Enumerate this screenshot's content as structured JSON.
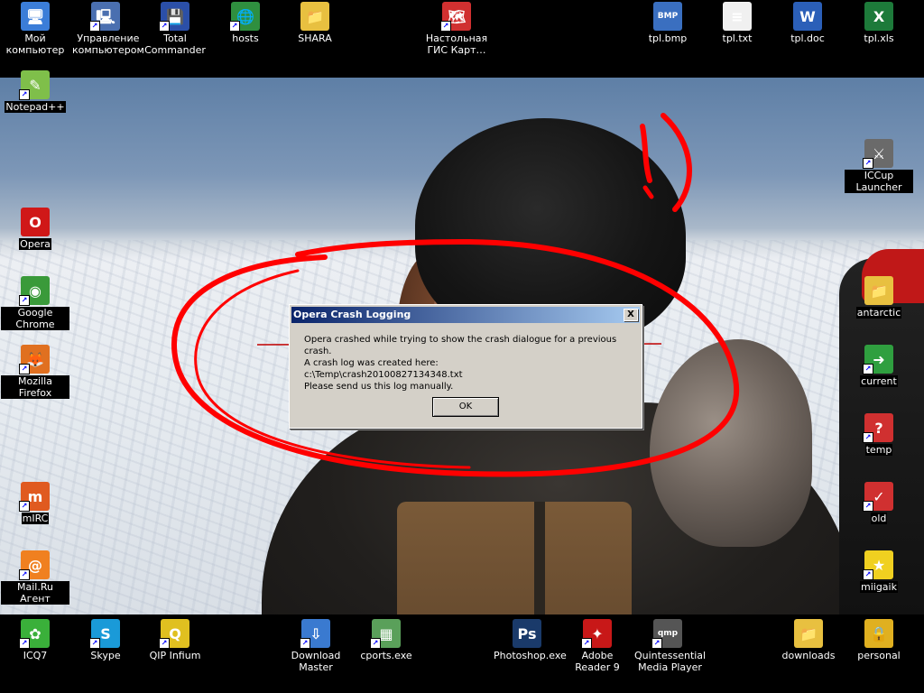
{
  "desktop": {
    "top_row": [
      {
        "name": "my-computer",
        "label": "Мой компьютер",
        "glyph": "🖥",
        "color": "#3b7dd8",
        "shortcut": false
      },
      {
        "name": "computer-management",
        "label": "Управление компьютером",
        "glyph": "🖳",
        "color": "#4a6fb0",
        "shortcut": true
      },
      {
        "name": "total-commander",
        "label": "Total Commander",
        "glyph": "💾",
        "color": "#2b4fa8",
        "shortcut": true
      },
      {
        "name": "hosts",
        "label": "hosts",
        "glyph": "🌐",
        "color": "#2f8f3f",
        "shortcut": true
      },
      {
        "name": "shara",
        "label": "SHARA",
        "glyph": "📁",
        "color": "#e8c040",
        "shortcut": false
      },
      {
        "name": "gis-kart",
        "label": "Настольная ГИС Карт…",
        "glyph": "🗺",
        "color": "#d03030",
        "shortcut": true
      },
      {
        "name": "tpl-bmp",
        "label": "tpl.bmp",
        "glyph": "BMP",
        "color": "#3a6fc0",
        "shortcut": false
      },
      {
        "name": "tpl-txt",
        "label": "tpl.txt",
        "glyph": "≡",
        "color": "#f0f0f0",
        "shortcut": false
      },
      {
        "name": "tpl-doc",
        "label": "tpl.doc",
        "glyph": "W",
        "color": "#2b5fb8",
        "shortcut": false
      },
      {
        "name": "tpl-xls",
        "label": "tpl.xls",
        "glyph": "X",
        "color": "#1d7a3a",
        "shortcut": false
      }
    ],
    "left_col": [
      {
        "name": "notepad-plus-plus",
        "label": "Notepad++",
        "glyph": "✎",
        "color": "#7fbf4a",
        "shortcut": true
      },
      {
        "name": "opera",
        "label": "Opera",
        "glyph": "O",
        "color": "#d01818",
        "shortcut": false
      },
      {
        "name": "google-chrome",
        "label": "Google Chrome",
        "glyph": "◉",
        "color": "#3a9a3a",
        "shortcut": true
      },
      {
        "name": "mozilla-firefox",
        "label": "Mozilla Firefox",
        "glyph": "🦊",
        "color": "#e07020",
        "shortcut": true
      },
      {
        "name": "mirc",
        "label": "mIRC",
        "glyph": "m",
        "color": "#e05a20",
        "shortcut": true
      },
      {
        "name": "mail-ru-agent",
        "label": "Mail.Ru Агент",
        "glyph": "@",
        "color": "#f08020",
        "shortcut": true
      }
    ],
    "right_col": [
      {
        "name": "iccup-launcher",
        "label": "ICCup Launcher",
        "glyph": "⚔",
        "color": "#6a6a6a",
        "shortcut": true
      },
      {
        "name": "antarctic",
        "label": "antarctic",
        "glyph": "📁",
        "color": "#e8c040",
        "shortcut": false
      },
      {
        "name": "current",
        "label": "current",
        "glyph": "➜",
        "color": "#2f9f3f",
        "shortcut": true
      },
      {
        "name": "temp",
        "label": "temp",
        "glyph": "?",
        "color": "#d03030",
        "shortcut": true
      },
      {
        "name": "old",
        "label": "old",
        "glyph": "✓",
        "color": "#d03030",
        "shortcut": true
      },
      {
        "name": "miigaik",
        "label": "miigaik",
        "glyph": "★",
        "color": "#f0d020",
        "shortcut": true
      }
    ],
    "bottom_row": [
      {
        "name": "icq7",
        "label": "ICQ7",
        "glyph": "✿",
        "color": "#3ab03a",
        "shortcut": true
      },
      {
        "name": "skype",
        "label": "Skype",
        "glyph": "S",
        "color": "#1a9ad8",
        "shortcut": true
      },
      {
        "name": "qip-infium",
        "label": "QIP Infium",
        "glyph": "Q",
        "color": "#e0c020",
        "shortcut": true
      },
      {
        "name": "download-master",
        "label": "Download Master",
        "glyph": "⇩",
        "color": "#3a7ad0",
        "shortcut": true
      },
      {
        "name": "cports",
        "label": "cports.exe",
        "glyph": "▦",
        "color": "#5aa05a",
        "shortcut": true
      },
      {
        "name": "photoshop",
        "label": "Photoshop.exe",
        "glyph": "Ps",
        "color": "#1a3a6a",
        "shortcut": false
      },
      {
        "name": "adobe-reader",
        "label": "Adobe Reader 9",
        "glyph": "✦",
        "color": "#c81818",
        "shortcut": true
      },
      {
        "name": "quintessential",
        "label": "Quintessential Media Player",
        "glyph": "qmp",
        "color": "#555555",
        "shortcut": true
      },
      {
        "name": "downloads",
        "label": "downloads",
        "glyph": "📁",
        "color": "#e8c040",
        "shortcut": false
      },
      {
        "name": "personal",
        "label": "personal",
        "glyph": "🔒",
        "color": "#e0b020",
        "shortcut": false
      }
    ]
  },
  "dialog": {
    "title": "Opera Crash Logging",
    "close_label": "X",
    "line1": "Opera crashed while trying to show the crash dialogue for a previous crash.",
    "line2": "A crash log was created here:",
    "line3": "c:\\Temp\\crash20100827134348.txt",
    "line4": "Please send us this log manually.",
    "ok_label": "OK"
  },
  "colors": {
    "titlebar_start": "#0a246a",
    "titlebar_end": "#a6caf0",
    "annotation_red": "#ff0000"
  }
}
